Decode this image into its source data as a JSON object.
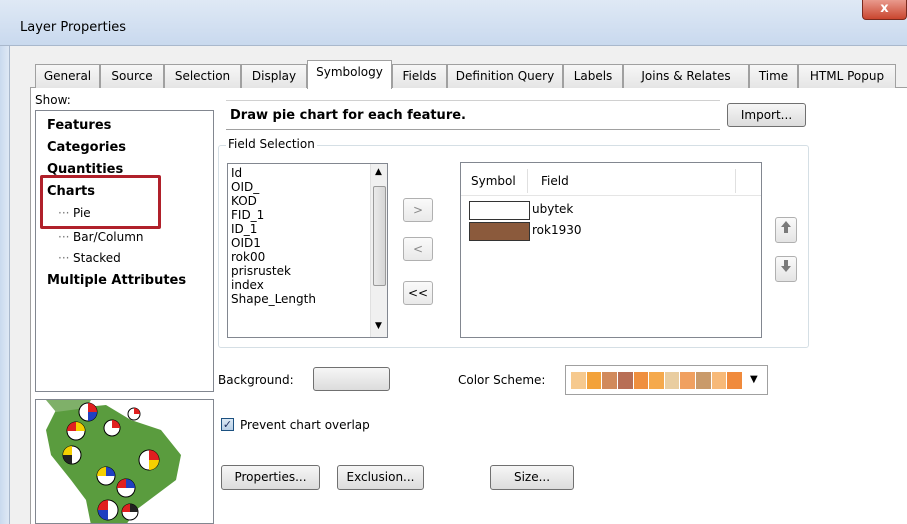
{
  "window": {
    "title": "Layer Properties",
    "close_glyph": "x"
  },
  "tabs": [
    {
      "label": "General"
    },
    {
      "label": "Source"
    },
    {
      "label": "Selection"
    },
    {
      "label": "Display"
    },
    {
      "label": "Symbology",
      "active": true
    },
    {
      "label": "Fields"
    },
    {
      "label": "Definition Query"
    },
    {
      "label": "Labels"
    },
    {
      "label": "Joins & Relates"
    },
    {
      "label": "Time"
    },
    {
      "label": "HTML Popup"
    }
  ],
  "show": {
    "label": "Show:",
    "items": [
      "Features",
      "Categories",
      "Quantities",
      "Charts",
      "Pie",
      "Bar/Column",
      "Stacked",
      "Multiple Attributes"
    ]
  },
  "description": "Draw pie chart for each feature.",
  "import_button": "Import...",
  "field_selection": {
    "group_label": "Field Selection",
    "fields": [
      "Id",
      "OID_",
      "KOD",
      "FID_1",
      "ID_1",
      "OID1",
      "rok00",
      "prisrustek",
      "index",
      "Shape_Length"
    ],
    "add_button": ">",
    "remove_button": "<",
    "remove_all_button": "<<"
  },
  "symbol_table": {
    "columns": [
      "Symbol",
      "Field"
    ],
    "rows": [
      {
        "field": "ubytek",
        "color": "#ffffff"
      },
      {
        "field": "rok1930",
        "color": "#8b5a3c"
      }
    ]
  },
  "background_label": "Background:",
  "color_scheme_label": "Color Scheme:",
  "color_scheme": [
    "#f6c98e",
    "#f3a23a",
    "#d18a5c",
    "#b86e55",
    "#ef8f3f",
    "#f5a94c",
    "#e9cda0",
    "#f0a060",
    "#c99a6a",
    "#f7b978",
    "#f08a3c"
  ],
  "prevent_overlap": {
    "label": "Prevent chart overlap",
    "checked": true
  },
  "buttons": {
    "properties": "Properties...",
    "exclusion": "Exclusion...",
    "size": "Size..."
  },
  "icons": {
    "move_up": "arrow-up-icon",
    "move_down": "arrow-down-icon",
    "dropdown": "chevron-down-icon"
  }
}
